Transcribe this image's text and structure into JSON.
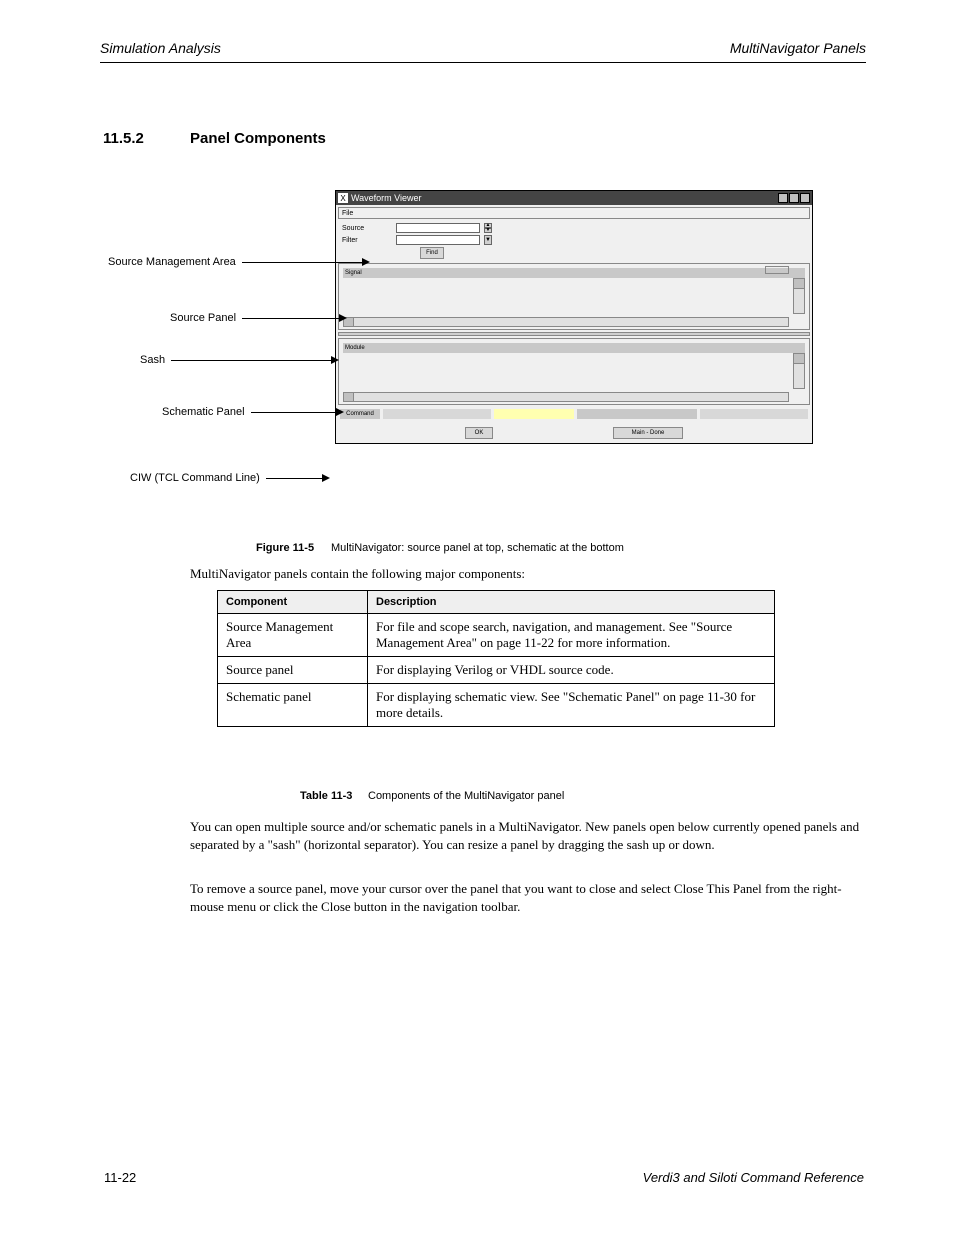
{
  "header": {
    "left": "Simulation Analysis",
    "right": "MultiNavigator Panels"
  },
  "section": {
    "num": "11.5.2",
    "title": "Panel Components"
  },
  "callouts": {
    "c1": "Source Management Area",
    "c2": "Source Panel",
    "c3": "Sash",
    "c4": "Schematic Panel",
    "c5": "CIW (TCL Command Line)"
  },
  "window": {
    "title": "Waveform Viewer",
    "file_menu": "File",
    "spin_label": "Source",
    "drop_label": "Filter",
    "find": "Find",
    "hdr1": "Signal",
    "hdr2": "Module",
    "apply": "OK",
    "done": "Main - Done",
    "cmd": "Command"
  },
  "fig": {
    "lead": "Figure 11-5",
    "rest": " MultiNavigator: source panel at top, schematic at the bottom"
  },
  "table_intro": "MultiNavigator panels contain the following major components:",
  "table": {
    "h1": "Component",
    "h2": "Description",
    "rows": [
      {
        "c1": "Source Management Area",
        "c2": "For file and scope search, navigation, and management. See \"Source Management Area\" on page 11-22 for more information."
      },
      {
        "c1": "Source panel",
        "c2": "For displaying Verilog or VHDL source code."
      },
      {
        "c1": "Schematic panel",
        "c2": "For displaying schematic view. See \"Schematic Panel\" on page 11-30 for more details."
      }
    ]
  },
  "tab": {
    "lead": "Table 11-3",
    "rest": " Components of the MultiNavigator panel"
  },
  "para1": "You can open multiple source and/or schematic panels in a MultiNavigator. New panels open below currently opened panels and separated by a \"sash\" (horizontal separator). You can resize a panel by dragging the sash up or down.",
  "para2": "To remove a source panel, move your cursor over the panel that you want to close and select Close This Panel from the right-mouse menu or click the Close button in the navigation toolbar.",
  "footer": {
    "page": "11-22",
    "text": "Verdi3 and Siloti Command Reference"
  }
}
